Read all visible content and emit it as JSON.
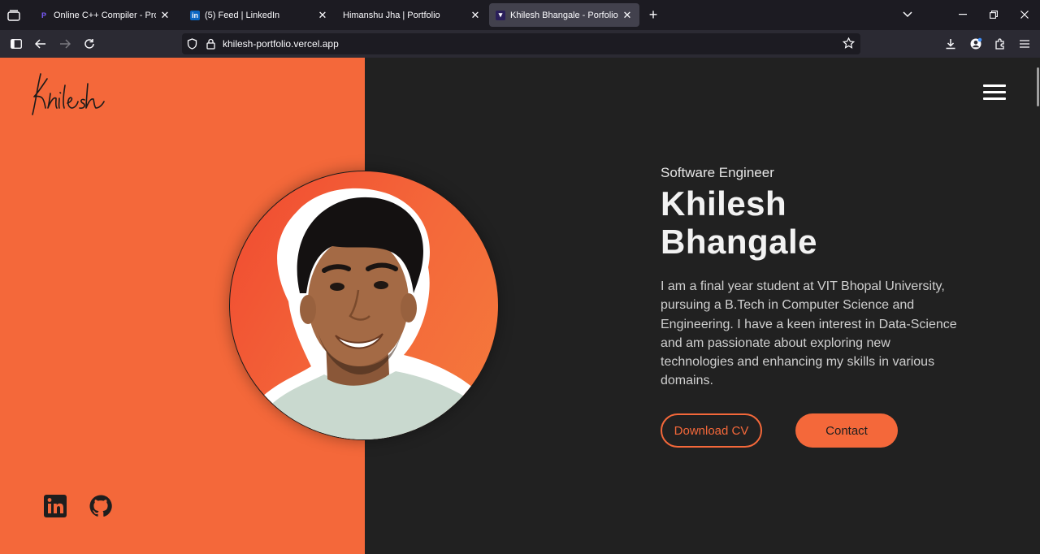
{
  "browser": {
    "tabs": [
      {
        "title": "Online C++ Compiler - Programiz",
        "favicon": "programiz-icon",
        "active": false
      },
      {
        "title": "(5) Feed | LinkedIn",
        "favicon": "linkedin-icon",
        "active": false
      },
      {
        "title": "Himanshu Jha | Portfolio",
        "favicon": "",
        "active": false
      },
      {
        "title": "Khilesh Bhangale - Porfolio",
        "favicon": "portfolio-icon",
        "active": true
      }
    ],
    "url": "khilesh-portfolio.vercel.app"
  },
  "page": {
    "logo_text": "Khilesh",
    "subtitle": "Software Engineer",
    "name_line1": "Khilesh",
    "name_line2": "Bhangale",
    "bio": "I am a final year student at VIT Bhopal University, pursuing a B.Tech in Computer Science and Engineering. I have a keen interest in Data-Science and am passionate about exploring new technologies and enhancing my skills in various domains.",
    "buttons": {
      "download_cv": "Download CV",
      "contact": "Contact"
    },
    "social": [
      "linkedin-icon",
      "github-icon"
    ],
    "colors": {
      "accent": "#f4683a",
      "background": "#212121",
      "text": "#f2f2f2"
    }
  }
}
